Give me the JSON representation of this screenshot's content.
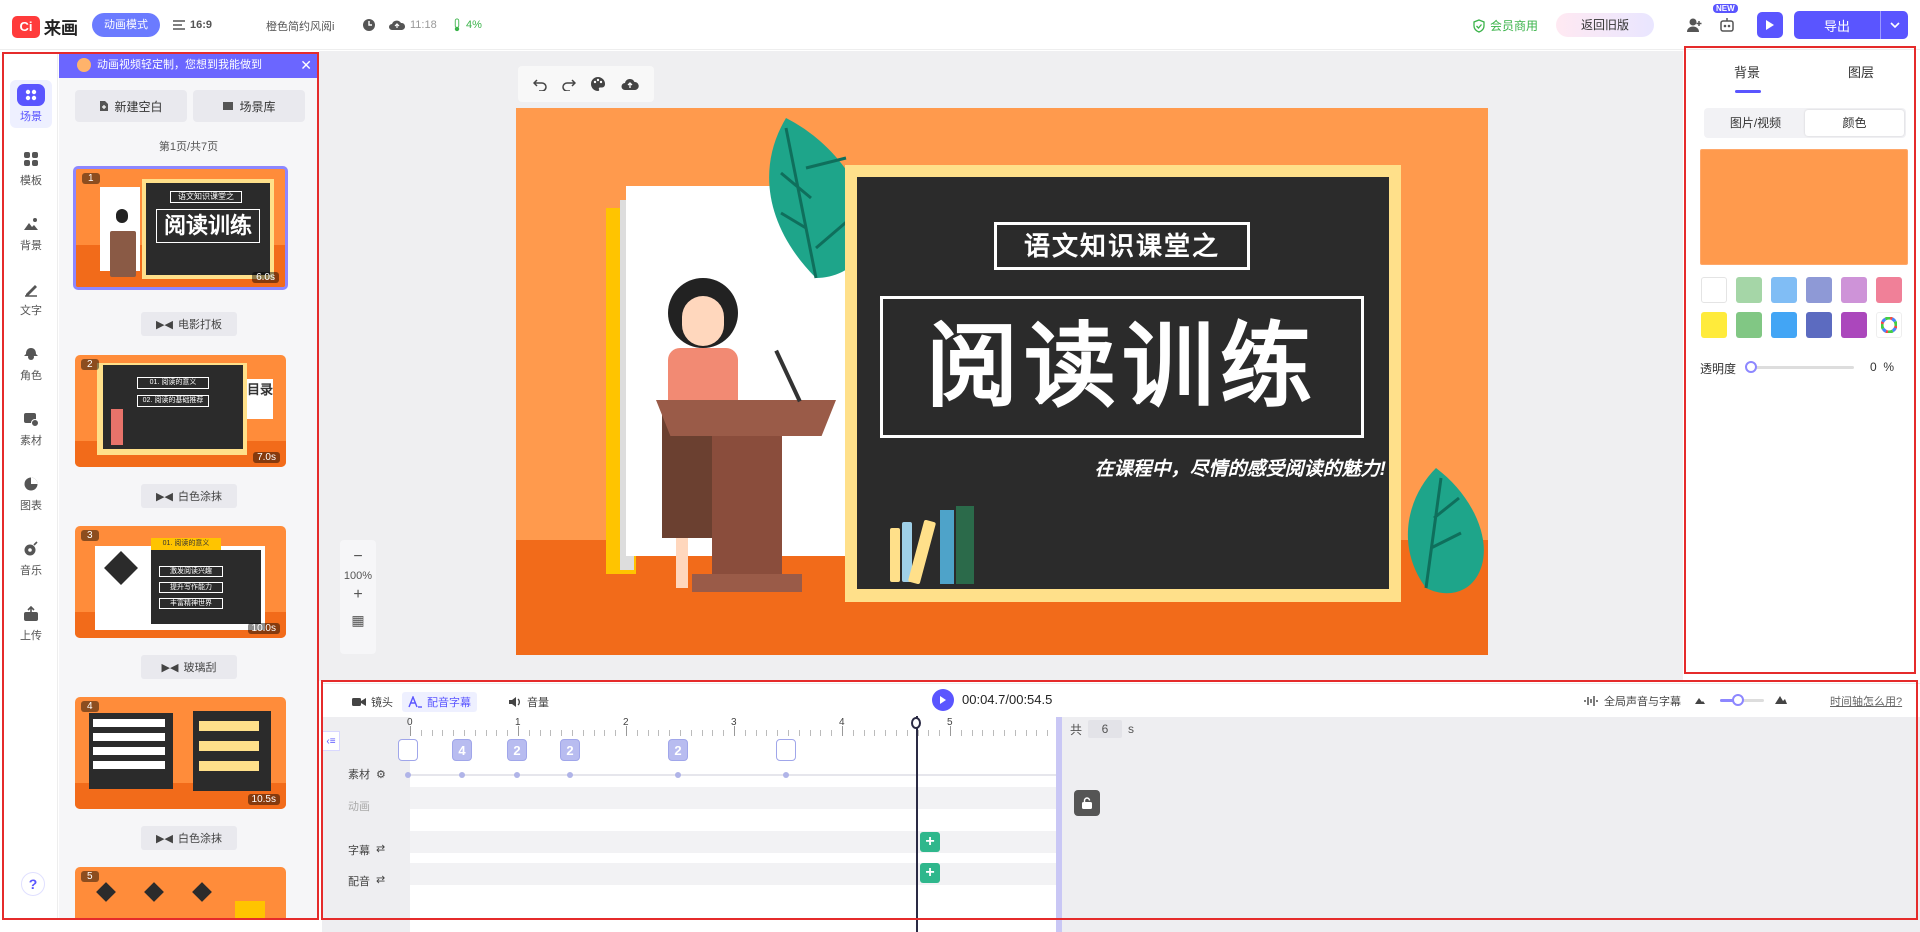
{
  "topbar": {
    "logo_mark": "Ci",
    "logo_text": "来画",
    "mode": "动画模式",
    "ratio": "16:9",
    "project_name": "橙色简约风阅i",
    "time": "11:18",
    "percent": "4%",
    "vip": "会员商用",
    "old_version": "返回旧版",
    "new_badge": "NEW",
    "export": "导出"
  },
  "nav": {
    "items": [
      {
        "label": "场景",
        "icon": "scene-icon"
      },
      {
        "label": "模板",
        "icon": "template-icon"
      },
      {
        "label": "背景",
        "icon": "background-icon"
      },
      {
        "label": "文字",
        "icon": "text-icon"
      },
      {
        "label": "角色",
        "icon": "character-icon"
      },
      {
        "label": "素材",
        "icon": "material-icon"
      },
      {
        "label": "图表",
        "icon": "chart-icon"
      },
      {
        "label": "音乐",
        "icon": "music-icon"
      },
      {
        "label": "上传",
        "icon": "upload-icon"
      }
    ],
    "help": "?"
  },
  "scenes": {
    "promo": "动画视频轻定制，您想到我能做到",
    "new_blank": "新建空白",
    "library": "场景库",
    "page_count": "第1页/共7页",
    "thumbs": [
      {
        "num": "1",
        "duration": "6.0s",
        "transition": "电影打板"
      },
      {
        "num": "2",
        "duration": "7.0s",
        "transition": "白色涂抹"
      },
      {
        "num": "3",
        "duration": "10.0s",
        "transition": "玻璃刮"
      },
      {
        "num": "4",
        "duration": "10.5s",
        "transition": "白色涂抹"
      },
      {
        "num": "5",
        "duration": "",
        "transition": ""
      }
    ],
    "thumb1_sub": "语文知识课堂之",
    "thumb1_main": "阅读训练",
    "thumb2_items": [
      "01. 阅读的意义",
      "02. 阅读的基础推荐"
    ],
    "thumb2_side": "目录",
    "thumb3_items": [
      "01. 阅读的意义",
      "激发阅读兴趣",
      "提升写作能力",
      "丰富精神世界"
    ]
  },
  "zoom": {
    "level": "100%"
  },
  "canvas": {
    "sub_title": "语文知识课堂之",
    "main_title": "阅读训练",
    "slogan": "在课程中，尽情的感受阅读的魅力!"
  },
  "right": {
    "tab_background": "背景",
    "tab_layer": "图层",
    "seg_image": "图片/视频",
    "seg_color": "颜色",
    "selected_color": "#ff9a4d",
    "swatches": [
      "#ffffff",
      "#a5d6a7",
      "#80bdf5",
      "#8e99d6",
      "#ce93d8",
      "#f08098",
      "#ffeb3b",
      "#81c784",
      "#42a5f5",
      "#5c6bc0",
      "#ab47bc",
      "rainbow"
    ],
    "opacity_label": "透明度",
    "opacity_value": "0",
    "opacity_unit": "%"
  },
  "timeline": {
    "tab_camera": "镜头",
    "tab_subtitle": "配音字幕",
    "tab_volume": "音量",
    "time": "00:04.7/00:54.5",
    "global_audio": "全局声音与字幕",
    "help": "时间轴怎么用?",
    "total_label": "共",
    "total_value": "6",
    "total_unit": "s",
    "ruler": [
      "0",
      "1",
      "2",
      "3",
      "4",
      "5"
    ],
    "rows": {
      "material": "素材",
      "animation": "动画",
      "subtitle": "字幕",
      "dub": "配音"
    },
    "chips": [
      "",
      "4",
      "2",
      "2",
      "2",
      ""
    ]
  }
}
